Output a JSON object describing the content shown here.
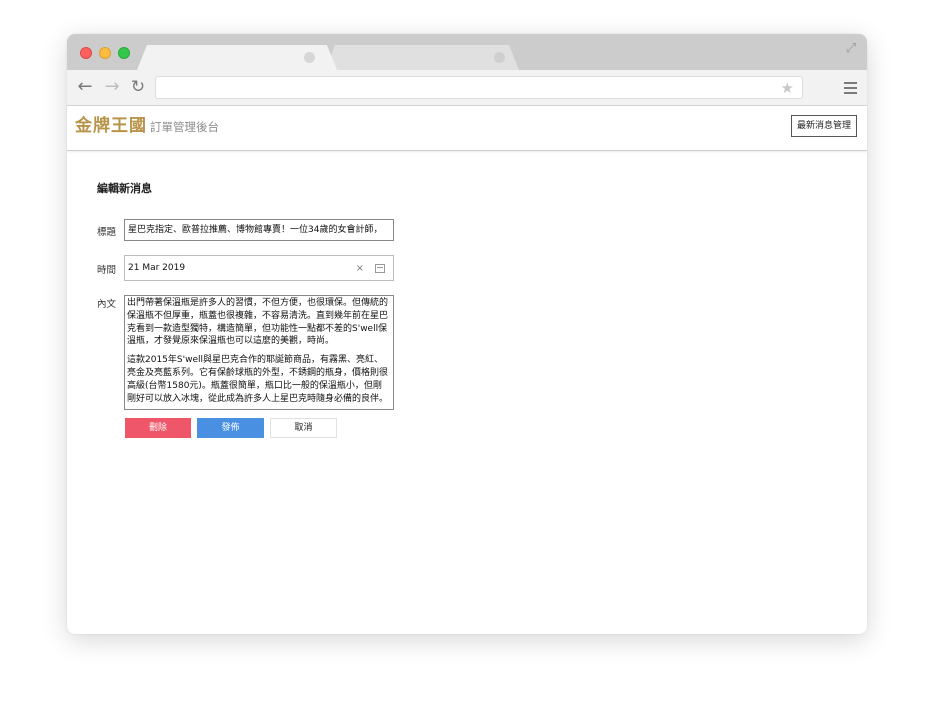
{
  "browser": {
    "tabs": [
      {
        "label": "",
        "active": true
      },
      {
        "label": "",
        "active": false
      }
    ],
    "address": "",
    "icons": [
      "back-icon",
      "forward-icon",
      "reload-icon",
      "bookmark-star-icon",
      "menu-icon",
      "fullscreen-icon"
    ]
  },
  "app": {
    "brand": "金牌王國",
    "subtitle": "訂單管理後台",
    "nav_button": "最新消息管理",
    "brand_color": "#b8944a"
  },
  "form": {
    "page_title": "編輯新消息",
    "title_label": "標題",
    "title_value": "星巴克指定、歐普拉推薦、博物館專賣！一位34歲的女會計師，",
    "date_label": "時間",
    "date_value": "21 Mar 2019",
    "date_clear": "×",
    "body_label": "內文",
    "body_paragraphs": [
      "出門帶著保溫瓶是許多人的習慣，不但方便，也很環保。但傳統的保溫瓶不但厚重，瓶蓋也很複雜，不容易清洗。直到幾年前在星巴克看到一款造型獨特，構造簡單，但功能性一點都不差的S'well保溫瓶，才發覺原來保溫瓶也可以這麼的美觀，時尚。",
      "這款2015年S'well與星巴克合作的耶誕節商品，有霧黑、亮紅、亮金及亮藍系列。它有保齡球瓶的外型，不銹鋼的瓶身，價格則很高級(台幣1580元)。瓶蓋很簡單，瓶口比一般的保溫瓶小，但剛剛好可以放入冰塊，從此成為許多人上星巴克時隨身必備的良伴。"
    ]
  },
  "actions": {
    "delete": "刪除",
    "publish": "發佈",
    "cancel": "取消",
    "delete_color": "#f0566a",
    "publish_color": "#4a90e2"
  }
}
